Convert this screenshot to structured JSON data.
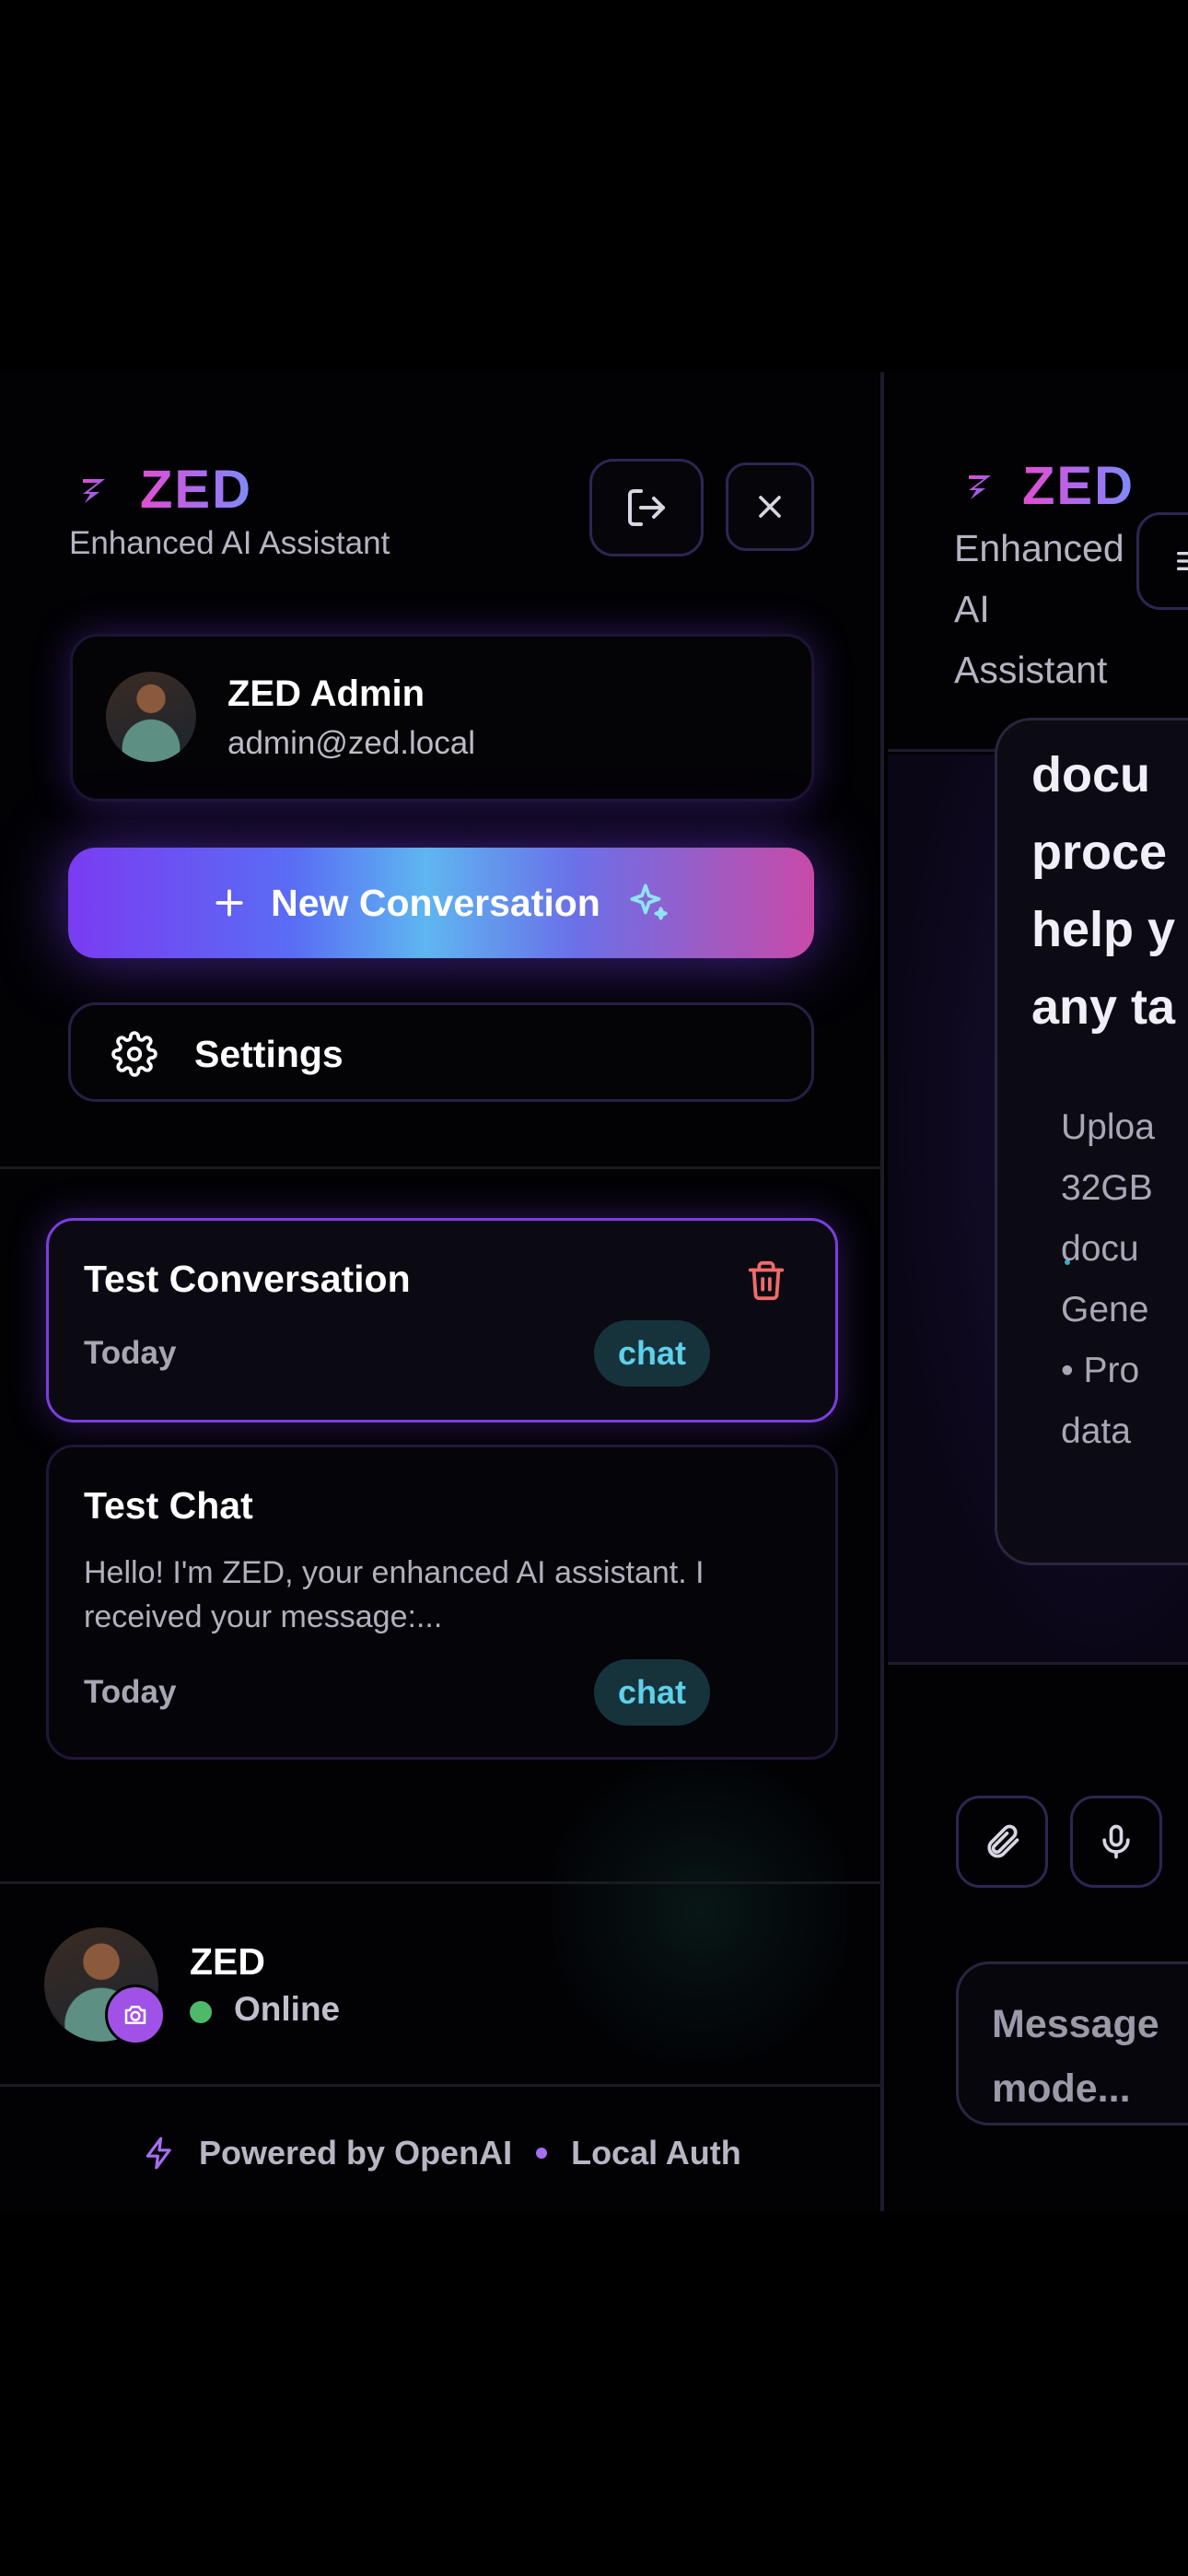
{
  "sidebar": {
    "brand": {
      "name": "ZED",
      "subtitle": "Enhanced AI Assistant"
    },
    "user": {
      "name": "ZED Admin",
      "email": "admin@zed.local"
    },
    "new_conversation_label": "New Conversation",
    "settings_label": "Settings",
    "conversations": [
      {
        "title": "Test Conversation",
        "date": "Today",
        "tag": "chat",
        "active": true
      },
      {
        "title": "Test Chat",
        "preview": "Hello! I'm ZED, your enhanced AI assistant. I received your message:...",
        "date": "Today",
        "tag": "chat",
        "active": false
      }
    ],
    "footer_user": {
      "name": "ZED",
      "status": "Online"
    },
    "powered": {
      "left": "Powered by OpenAI",
      "right": "Local Auth"
    }
  },
  "main": {
    "brand": {
      "name": "ZED",
      "subtitle": "Enhanced\nAI\nAssistant"
    },
    "message_text": "docu\nproce\nhelp y\nany ta",
    "message_subtext": "Uploa\n32GB\ndocu\nGene\n• Pro\ndata",
    "input_placeholder": "Message\nmode..."
  },
  "colors": {
    "accent": "#7b3ee0",
    "chip_text": "#5fd0ea",
    "online": "#4fb96a",
    "trash": "#f26a6a"
  },
  "icons": [
    "zed-logo-icon",
    "logout-icon",
    "close-icon",
    "plus-icon",
    "sparkles-icon",
    "gear-icon",
    "trash-icon",
    "camera-icon",
    "bolt-icon",
    "menu-icon",
    "paperclip-icon",
    "microphone-icon"
  ]
}
